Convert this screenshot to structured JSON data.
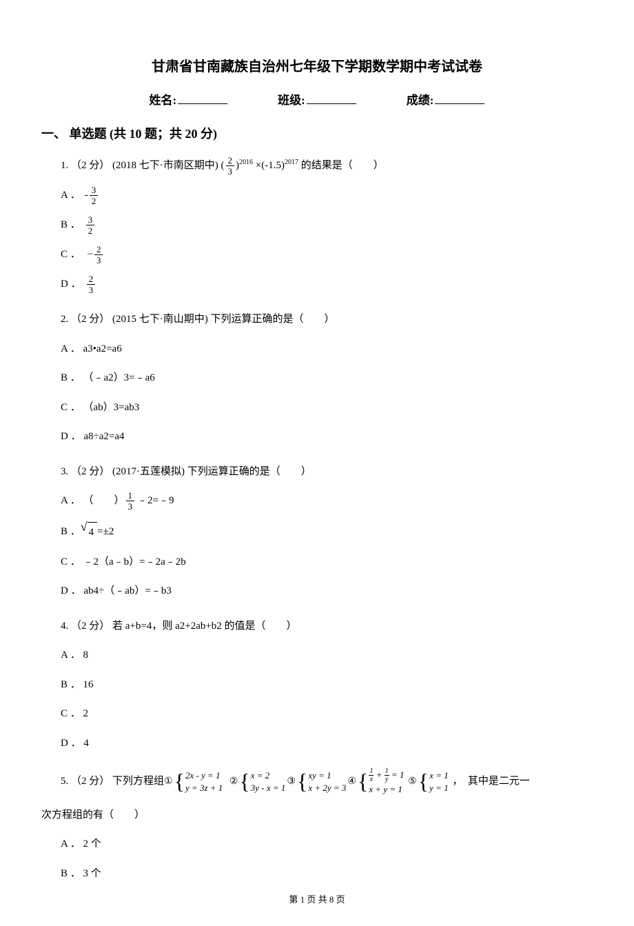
{
  "title": "甘肃省甘南藏族自治州七年级下学期数学期中考试试卷",
  "info": {
    "name_label": "姓名:",
    "class_label": "班级:",
    "score_label": "成绩:"
  },
  "section1_header": "一、 单选题 (共 10 题；共 20 分)",
  "q1": {
    "prefix": "1. （2 分） (2018 七下·市南区期中)",
    "expr_base1_num": "2",
    "expr_base1_den": "3",
    "expr_exp1": "2016",
    "expr_base2": "(-1.5)",
    "expr_exp2": "2017",
    "tail": " 的结果是（　　）",
    "A_num": "3",
    "A_den": "2",
    "A_sign": "-",
    "B_num": "3",
    "B_den": "2",
    "C_num": "2",
    "C_den": "3",
    "C_sign": "−",
    "D_num": "2",
    "D_den": "3"
  },
  "q2": {
    "stem": "2. （2 分） (2015 七下·南山期中) 下列运算正确的是（　　）",
    "A": "A ． a3•a2=a6",
    "B": "B ． （﹣a2）3=﹣a6",
    "C": "C ． （ab）3=ab3",
    "D": "D ． a8÷a2=a4"
  },
  "q3": {
    "stem": "3. （2 分） (2017·五莲模拟) 下列运算正确的是（　　）",
    "A_pre": "A ． （　　）",
    "A_frac_num": "1",
    "A_frac_den": "3",
    "A_post": "﹣2=﹣9",
    "B_pre": "B ．",
    "B_sqrt": "4",
    "B_post": " =±2",
    "C": "C ． ﹣2（a﹣b）=﹣2a﹣2b",
    "D": "D ． ab4÷（﹣ab）=﹣b3"
  },
  "q4": {
    "stem": "4. （2 分）  若 a+b=4，则 a2+2ab+b2 的值是（　　）",
    "A": "A ． 8",
    "B": "B ． 16",
    "C": "C ． 2",
    "D": "D ． 4"
  },
  "q5": {
    "prefix": "5. （2 分） 下列方程组",
    "c1": "①",
    "s1a": "2x - y = 1",
    "s1b": "y = 3z + 1",
    "c2": "②",
    "s2a": "x = 2",
    "s2b": "3y - x = 1",
    "c3": "③",
    "s3a": "xy = 1",
    "s3b": "x + 2y = 3",
    "c4": "④",
    "s4a_l": "1",
    "s4a_m": "x",
    "s4a_r": "1",
    "s4a_d": "y",
    "s4a_eq": "= 1",
    "s4b": "x + y = 1",
    "c5": "⑤",
    "s5a": "x = 1",
    "s5b": "y = 1",
    "tail": " ，　其中是二元一",
    "line2": "次方程组的有（　　）",
    "A": "A ． 2 个",
    "B": "B ． 3 个"
  },
  "footer": "第 1 页 共 8 页"
}
